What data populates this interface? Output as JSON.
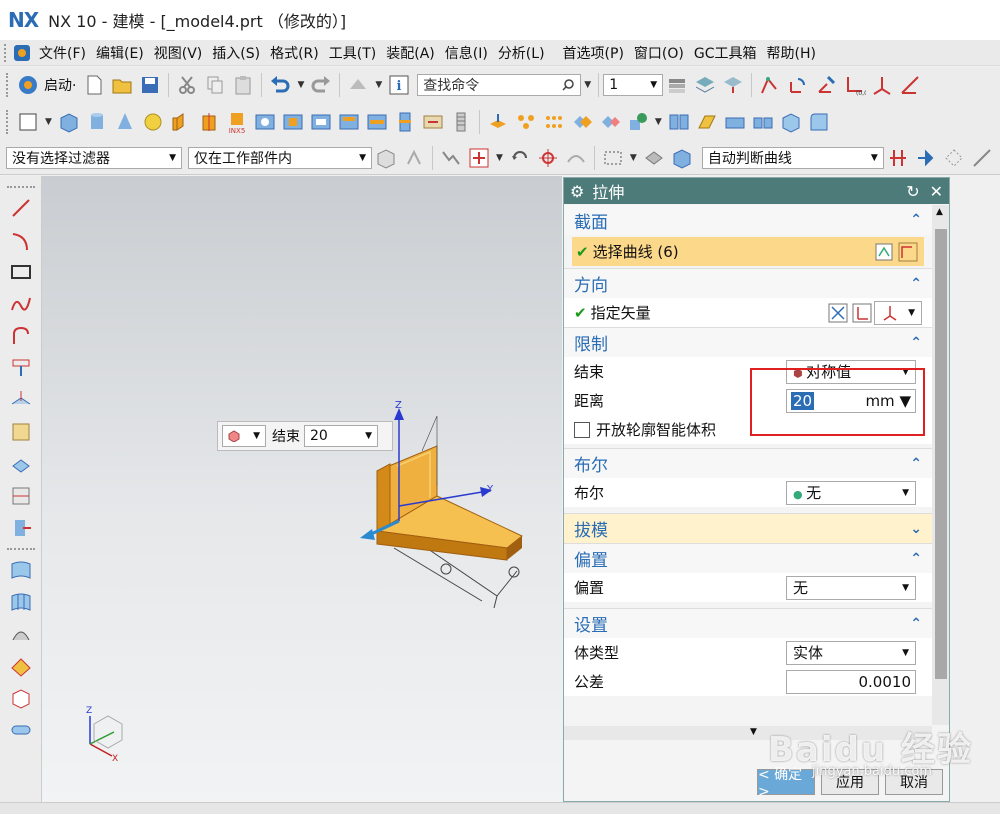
{
  "window": {
    "logo": "NX",
    "title": "NX 10 - 建模 - [_model4.prt （修改的）]"
  },
  "menu": {
    "items": [
      "文件(F)",
      "编辑(E)",
      "视图(V)",
      "插入(S)",
      "格式(R)",
      "工具(T)",
      "装配(A)",
      "信息(I)",
      "分析(L)",
      "首选项(P)",
      "窗口(O)",
      "GC工具箱",
      "帮助(H)"
    ]
  },
  "toolbar1": {
    "start_label": "启动·",
    "search_placeholder": "查找命令",
    "layer_value": "1"
  },
  "toolbar3": {
    "filter_value": "没有选择过滤器",
    "scope_value": "仅在工作部件内",
    "curve_rule_value": "自动判断曲线"
  },
  "viewport": {
    "float_label": "结束",
    "float_value": "20",
    "axis_z": "Z",
    "axis_y": "Y",
    "triad_z": "Z",
    "triad_x": "X"
  },
  "dialog": {
    "title": "拉伸",
    "sections": {
      "section": {
        "title": "截面",
        "select_curve": "选择曲线 (6)"
      },
      "direction": {
        "title": "方向",
        "specify_vector": "指定矢量"
      },
      "limits": {
        "title": "限制",
        "end_label": "结束",
        "end_value": "对称值",
        "distance_label": "距离",
        "distance_value": "20",
        "distance_unit": "mm",
        "open_profile_label": "开放轮廓智能体积"
      },
      "boolean": {
        "title": "布尔",
        "label": "布尔",
        "value": "无"
      },
      "draft": {
        "title": "拔模"
      },
      "offset": {
        "title": "偏置",
        "label": "偏置",
        "value": "无"
      },
      "settings": {
        "title": "设置",
        "body_type_label": "体类型",
        "body_type_value": "实体",
        "tolerance_label": "公差",
        "tolerance_value": "0.0010"
      }
    },
    "buttons": {
      "ok": "< 确定 >",
      "apply": "应用",
      "cancel": "取消"
    }
  },
  "watermark": {
    "text": "Baidu 经验",
    "sub": "jingyan.baidu.com"
  },
  "colors": {
    "accent": "#2a6db5",
    "dialog_title": "#4d7b7a",
    "highlight": "#fcd88a",
    "model": "#f0a020",
    "annotation": "#e02020"
  }
}
